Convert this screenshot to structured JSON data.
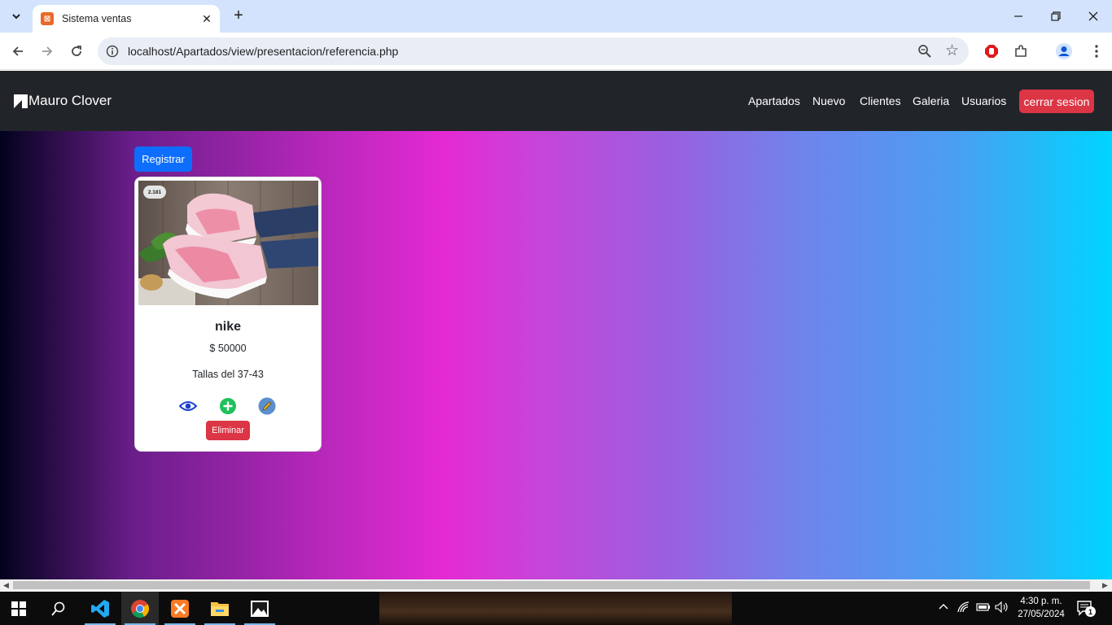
{
  "browser": {
    "tab_title": "Sistema ventas",
    "url": "localhost/Apartados/view/presentacion/referencia.php"
  },
  "navbar": {
    "brand": "Mauro Clover",
    "links": [
      "Apartados",
      "Nuevo",
      "Clientes",
      "Galeria",
      "Usuarios"
    ],
    "logout_label": "cerrar sesion"
  },
  "page": {
    "register_label": "Registrar"
  },
  "product": {
    "badge": "2.181",
    "name": "nike",
    "price": "$ 50000",
    "description": "Tallas del 37-43",
    "delete_label": "Eliminar"
  },
  "taskbar": {
    "time": "4:30 p. m.",
    "date": "27/05/2024",
    "notification_count": "1"
  },
  "colors": {
    "navbar_bg": "#212529",
    "danger": "#dc3545",
    "primary": "#0d6efd",
    "success": "#20c05c"
  }
}
